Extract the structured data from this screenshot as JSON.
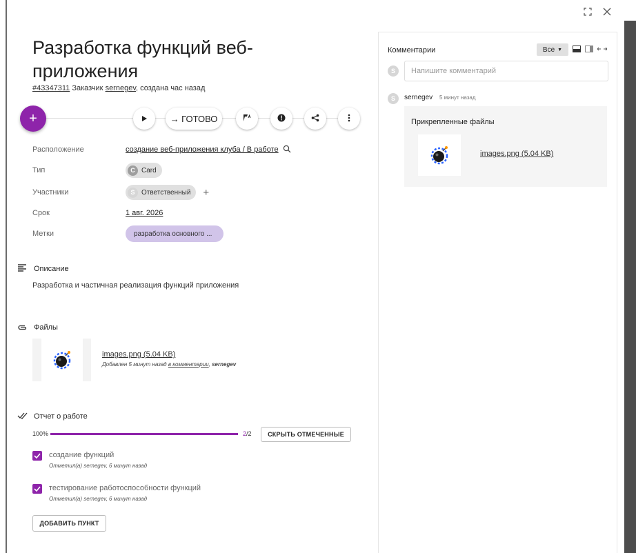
{
  "window": {
    "fullscreen_icon": "fullscreen-icon",
    "close_icon": "close-icon"
  },
  "task": {
    "title": "Разработка функций веб-приложения",
    "id_link": "#43347311",
    "customer_label": "Заказчик",
    "customer": "sernegev",
    "created": ", создана час назад"
  },
  "toolbar": {
    "add_label": "+",
    "play_icon": "play-icon",
    "done_label": "→ ГОТОВО",
    "flag_icon": "flag-icon",
    "priority_icon": "priority-icon",
    "share_icon": "share-icon",
    "more_icon": "more-icon"
  },
  "props": {
    "location_label": "Расположение",
    "location_value": "создание веб-приложения клуба / В работе",
    "type_label": "Тип",
    "type_avatar": "C",
    "type_value": "Card",
    "members_label": "Участники",
    "member_avatar": "S",
    "member_value": "Ответственный",
    "add_member": "+",
    "due_label": "Срок",
    "due_value": "1 авг. 2026",
    "tags_label": "Метки",
    "tag_value": "разработка основного ..."
  },
  "description": {
    "heading": "Описание",
    "text": "Разработка и частичная реализация функций приложения"
  },
  "files": {
    "heading": "Файлы",
    "file_name": "images.png (5.04 KB)",
    "meta_prefix": "Добавлен 5 минут назад ",
    "meta_link": "в комментарии",
    "meta_sep": ", ",
    "meta_author": "sernegev"
  },
  "report": {
    "heading": "Отчет о работе",
    "percent_label": "100%",
    "progress": 1.0,
    "done": "2",
    "total": "/2",
    "hide_button": "СКРЫТЬ ОТМЕЧЕННЫЕ",
    "items": [
      {
        "title": "создание функций",
        "meta": "Отметил(а) sernegev, 6 минут назад"
      },
      {
        "title": "тестирование работоспособности функций",
        "meta": "Отметил(а) sernegev, 6 минут назад"
      }
    ],
    "add_button": "ДОБАВИТЬ ПУНКТ"
  },
  "comments": {
    "title": "Комментарии",
    "filter_value": "Все",
    "input_placeholder": "Напишите комментарий",
    "my_avatar": "S",
    "entry": {
      "avatar": "S",
      "author": "sernegev",
      "time": "5 минут назад",
      "attach_title": "Прикрепленные файлы",
      "file_name": "images.png (5.04 KB)"
    }
  },
  "colors": {
    "accent": "#8e24aa",
    "tag_bg": "#d1c4e9"
  }
}
